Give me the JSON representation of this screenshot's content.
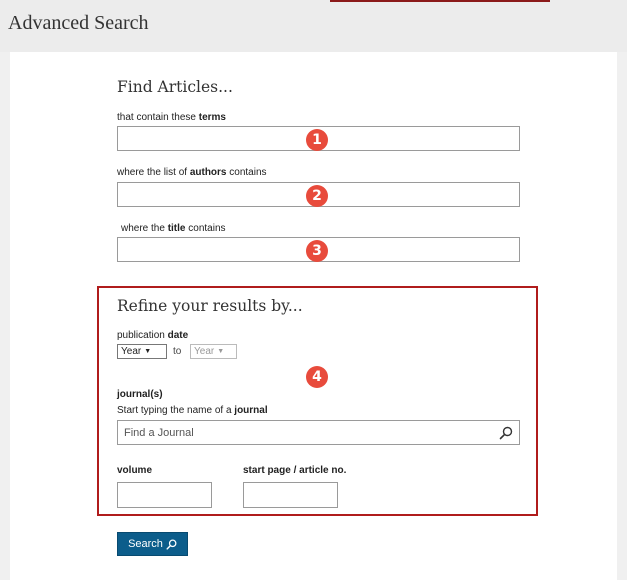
{
  "page_title": "Advanced Search",
  "find_articles": {
    "title": "Find Articles...",
    "terms_label_pre": "that contain these ",
    "terms_label_bold": "terms",
    "authors_label_pre": "where the list of ",
    "authors_label_bold": "authors",
    "authors_label_post": " contains",
    "title_label_pre": "where the ",
    "title_label_bold": "title",
    "title_label_post": " contains",
    "terms_value": "",
    "authors_value": "",
    "title_value": ""
  },
  "badges": [
    "1",
    "2",
    "3",
    "4"
  ],
  "refine": {
    "title": "Refine your results by...",
    "pub_label_pre": "publication ",
    "pub_label_bold": "date",
    "from_select": "Year",
    "to_text": "to",
    "to_select": "Year",
    "journals_label": "journal(s)",
    "journal_hint_pre": "Start typing the name of a ",
    "journal_hint_bold": "journal",
    "journal_placeholder": "Find a Journal",
    "volume_label": "volume",
    "start_page_label": "start page / article no.",
    "volume_value": "",
    "start_page_value": ""
  },
  "search_button": "Search",
  "colors": {
    "accent": "#0c5d8b",
    "highlight_border": "#b01c1c",
    "badge": "#e84b3c"
  }
}
